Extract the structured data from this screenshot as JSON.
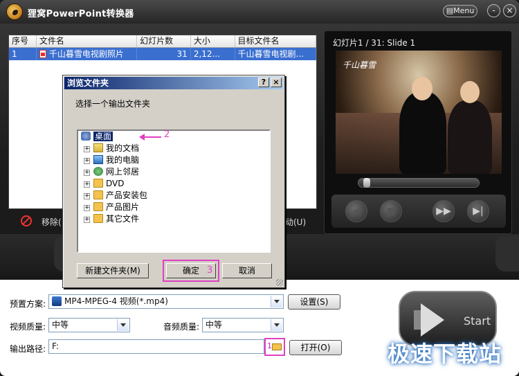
{
  "app": {
    "title": "狸窝PowerPoint转换器",
    "menu_label": "Menu",
    "minimize_label": "-",
    "close_label": "×"
  },
  "file_list": {
    "columns": [
      "序号",
      "文件名",
      "幻灯片数",
      "大小",
      "目标文件名"
    ],
    "rows": [
      {
        "index": "1",
        "filename": "千山暮雪电视剧照片",
        "slides": "31",
        "size": "2,12...",
        "target": "千山暮雪电视剧..."
      }
    ],
    "remove_label": "移除(",
    "move_label": "动(U)"
  },
  "preview": {
    "slide_info": "幻灯片1 / 31: Slide 1",
    "slide_caption": "千山暮雪",
    "controls": [
      "prev-icon",
      "stop-icon",
      "next-icon",
      "last-icon"
    ]
  },
  "settings": {
    "preset_label": "预置方案:",
    "preset_value": "MP4-MPEG-4 视频(*.mp4)",
    "settings_button": "设置(S)",
    "video_quality_label": "视频质量:",
    "video_quality_value": "中等",
    "audio_quality_label": "音频质量:",
    "audio_quality_value": "中等",
    "output_path_label": "输出路径:",
    "output_path_value": "F:",
    "open_button": "打开(O)",
    "annotation_1": "1",
    "start_label": "Start"
  },
  "watermark": "极速下载站",
  "dialog": {
    "title": "浏览文件夹",
    "help_label": "?",
    "close_label": "×",
    "prompt": "选择一个输出文件夹",
    "tree": [
      {
        "label": "桌面",
        "selected": true
      },
      {
        "label": "我的文档"
      },
      {
        "label": "我的电脑"
      },
      {
        "label": "网上邻居"
      },
      {
        "label": "DVD"
      },
      {
        "label": "产品安装包"
      },
      {
        "label": "产品图片"
      },
      {
        "label": "其它文件"
      }
    ],
    "annotation_2": "2",
    "new_folder_button": "新建文件夹(M)",
    "ok_button": "确定",
    "annotation_3": "3",
    "cancel_button": "取消"
  },
  "colors": {
    "selection": "#3a6fd0",
    "annotation": "#e040c0",
    "dialog_title": "#0a246a"
  }
}
